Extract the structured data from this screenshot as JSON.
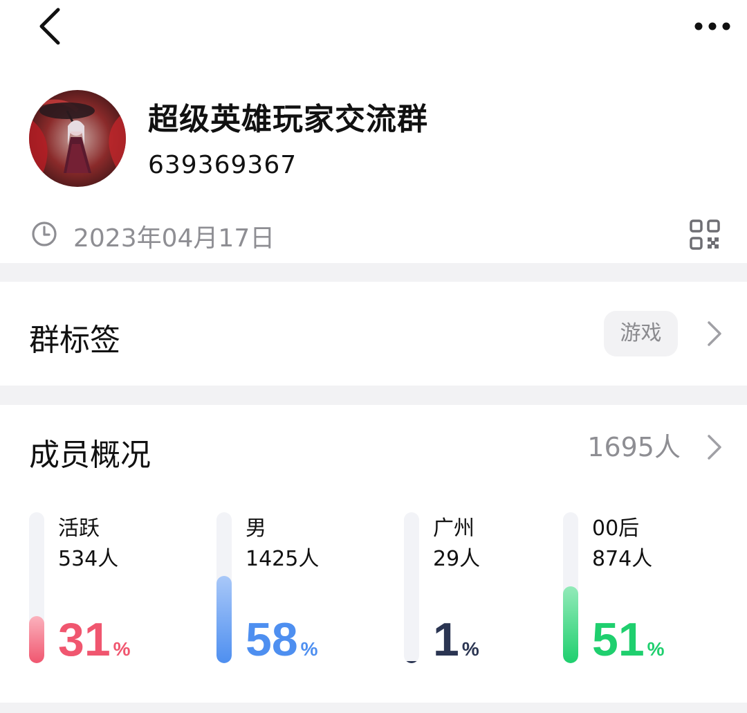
{
  "header": {
    "back_icon": "chevron-left-icon",
    "more_icon": "more-horizontal-icon"
  },
  "group": {
    "name": "超级英雄玩家交流群",
    "id": "639369367",
    "created_date": "2023年04月17日",
    "avatar_icon": "group-avatar",
    "qr_icon": "qr-code-icon",
    "clock_icon": "clock-icon"
  },
  "tags_section": {
    "title": "群标签",
    "tag": "游戏"
  },
  "members_section": {
    "title": "成员概况",
    "total": "1695人",
    "stats": [
      {
        "label": "活跃",
        "count": "534人",
        "percent": "31",
        "unit": "%",
        "fraction": 0.31,
        "color": "#f0566f",
        "color_light": "#fbb2bd"
      },
      {
        "label": "男",
        "count": "1425人",
        "percent": "58",
        "unit": "%",
        "fraction": 0.58,
        "color": "#4e8ff0",
        "color_light": "#a9c8f8"
      },
      {
        "label": "广州",
        "count": "29人",
        "percent": "1",
        "unit": "%",
        "fraction": 0.01,
        "color": "#2b3552",
        "color_light": "#2b3552"
      },
      {
        "label": "00后",
        "count": "874人",
        "percent": "51",
        "unit": "%",
        "fraction": 0.51,
        "color": "#1fcf6e",
        "color_light": "#93eab9"
      }
    ]
  }
}
